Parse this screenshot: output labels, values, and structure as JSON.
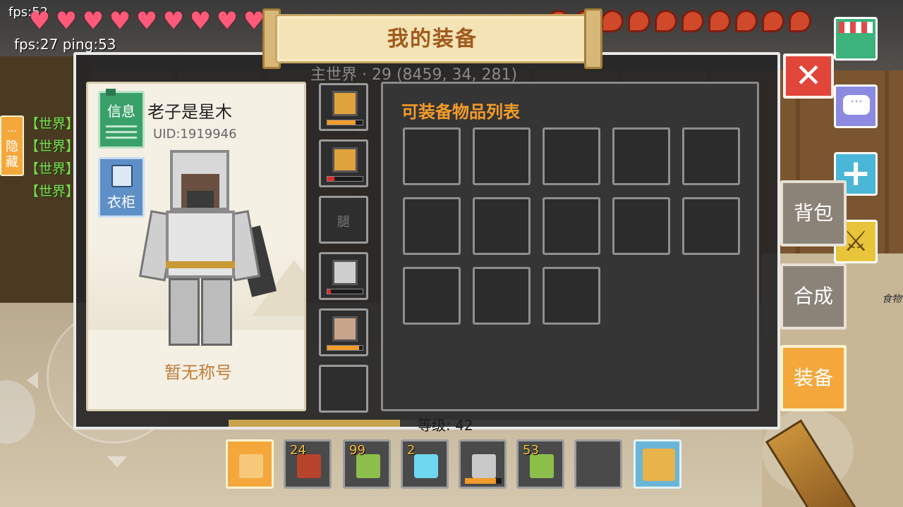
{
  "hud": {
    "fps_top": "fps:52",
    "fps_ping": "fps:27 ping:53",
    "hearts": 9,
    "food": 10,
    "world_info": "主世界 · 29  (8459, 34, 281)"
  },
  "chat": {
    "hide_label": "隐藏",
    "lines": [
      "【世界】",
      "【世界】",
      "【世界】",
      "【世界】"
    ]
  },
  "dialog": {
    "title": "我的装备",
    "player": {
      "name": "老子是星木",
      "uid": "UID:1919946",
      "title": "暂无称号",
      "info_label": "信息",
      "wardrobe_label": "衣柜"
    },
    "equipment_slots": [
      {
        "name": "helmet",
        "empty_label": "",
        "durability": 0.8
      },
      {
        "name": "chestplate",
        "empty_label": "",
        "durability": 0.2
      },
      {
        "name": "leggings",
        "empty_label": "腿",
        "durability": null
      },
      {
        "name": "boots",
        "empty_label": "",
        "durability": 0.1
      },
      {
        "name": "shield",
        "empty_label": "",
        "durability": 0.9
      },
      {
        "name": "extra",
        "empty_label": "",
        "durability": null
      }
    ],
    "items_title": "可装备物品列表",
    "item_slots": 13,
    "level_text": "等级: 42"
  },
  "side_tabs": {
    "backpack": "背包",
    "craft": "合成",
    "equip": "装备"
  },
  "close_symbol": "✕",
  "hotbar": [
    {
      "item": "feather",
      "count": "",
      "selected": true
    },
    {
      "item": "raw-meat",
      "count": "24"
    },
    {
      "item": "bamboo",
      "count": "99"
    },
    {
      "item": "diamond",
      "count": "2"
    },
    {
      "item": "pickaxe",
      "count": "",
      "durability": 0.85
    },
    {
      "item": "bamboo",
      "count": "53"
    },
    {
      "item": "empty",
      "count": ""
    },
    {
      "item": "backpack",
      "count": ""
    }
  ],
  "background": {
    "food_label": "食物"
  },
  "colors": {
    "accent_orange": "#f4a83c",
    "title_brown": "#a05a1e",
    "chat_green": "#7be04e",
    "close_red": "#e2453a"
  }
}
